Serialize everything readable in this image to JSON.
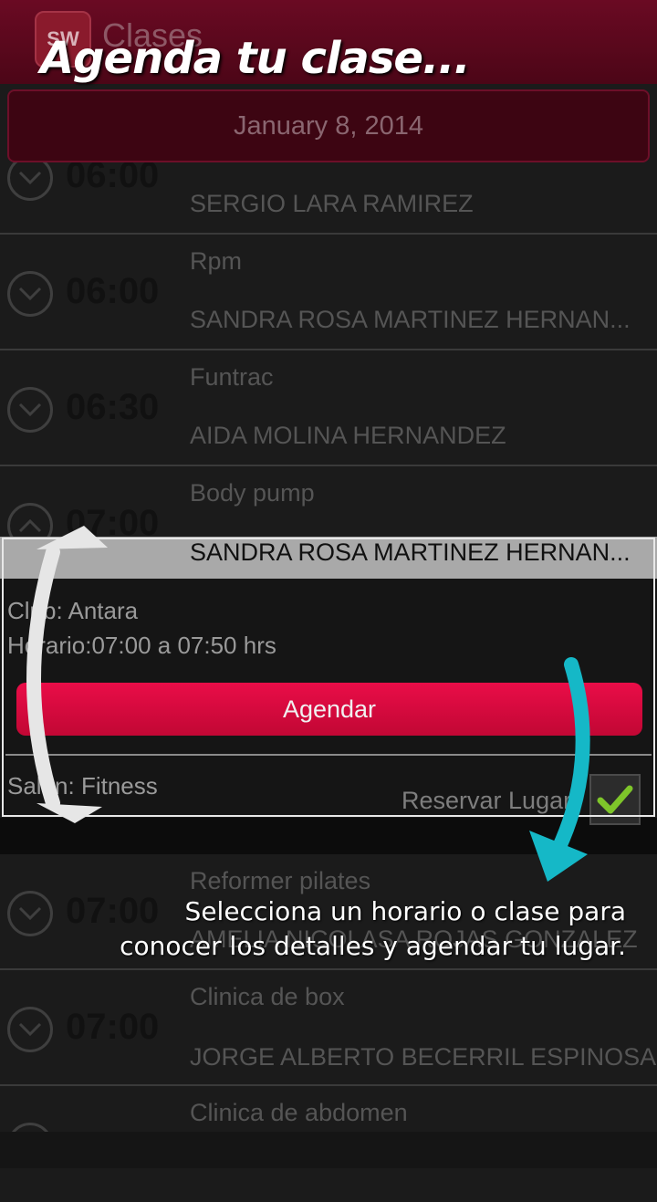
{
  "app": {
    "title": "Clases",
    "logo_text": "SW"
  },
  "date": "January 8, 2014",
  "overlay": {
    "headline": "Agenda tu clase...",
    "caption_line1": "Selecciona un horario o clase para",
    "caption_line2": "conocer los detalles y agendar tu lugar."
  },
  "classes": [
    {
      "time": "06:00",
      "name": "",
      "instructor": "SERGIO LARA RAMIREZ"
    },
    {
      "time": "06:00",
      "name": "Rpm",
      "instructor": "SANDRA ROSA MARTINEZ HERNAN..."
    },
    {
      "time": "06:30",
      "name": "Funtrac",
      "instructor": "AIDA MOLINA HERNANDEZ"
    },
    {
      "time": "07:00",
      "name": "Body pump",
      "instructor": "SANDRA ROSA MARTINEZ HERNAN..."
    },
    {
      "time": "07:00",
      "name": "Reformer pilates",
      "instructor": "AMELIA NICOLASA ROJAS GONZALEZ"
    },
    {
      "time": "07:00",
      "name": "Clinica de box",
      "instructor": "JORGE ALBERTO BECERRIL ESPINOSA"
    },
    {
      "time": "",
      "name": "Clinica de abdomen",
      "instructor": ""
    }
  ],
  "details": {
    "club": "Club: Antara",
    "horario": "Horario:07:00 a 07:50 hrs",
    "agendar_label": "Agendar",
    "salon": "Salón: Fitness",
    "reservar_label": "Reservar Lugar",
    "reservar_checked": true
  },
  "colors": {
    "action_bar": "#5a0a1e",
    "accent_button": "#d80a3e",
    "check_green": "#7ec52a",
    "arrow_teal": "#15b8c7"
  }
}
